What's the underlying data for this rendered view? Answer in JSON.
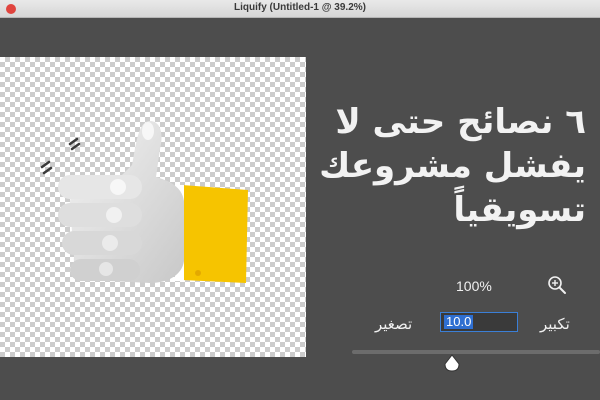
{
  "window": {
    "title": "Liquify (Untitled-1 @ 39.2%)"
  },
  "canvas": {
    "image_icon": "thumbs-up-icon"
  },
  "headline": {
    "lines": [
      "٦ نصائح حتى لا",
      "يفشل مشروعك",
      "تسويقياً"
    ]
  },
  "zoom": {
    "percent": "100%",
    "icon": "zoom-in-icon"
  },
  "brush_size": {
    "label_decrease": "تصغير",
    "label_increase": "تكبير",
    "value": "10.0",
    "slider_level": 0.37
  },
  "colors": {
    "background": "#4d4d4d",
    "selection": "#2f6fd1",
    "cuff": "#f6c400"
  }
}
